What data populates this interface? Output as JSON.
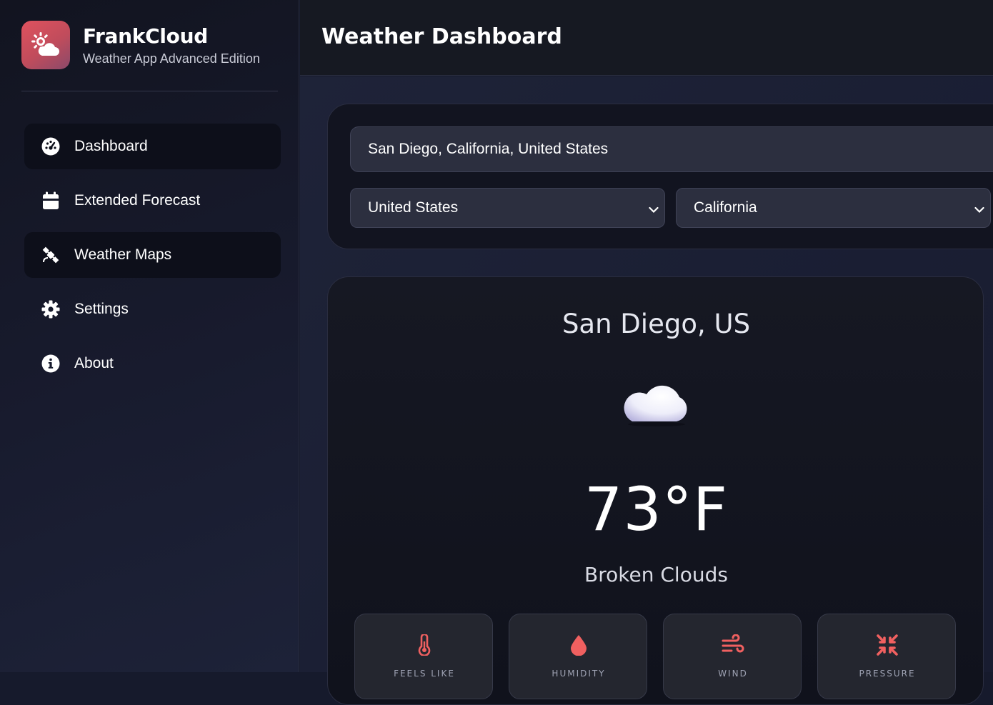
{
  "app": {
    "name": "FrankCloud",
    "subtitle": "Weather App Advanced Edition",
    "logo_icon": "sun-cloud-icon",
    "accent_color": "#e05460"
  },
  "sidebar": {
    "items": [
      {
        "label": "Dashboard",
        "icon": "gauge-icon",
        "active": true
      },
      {
        "label": "Extended Forecast",
        "icon": "calendar-icon",
        "active": false
      },
      {
        "label": "Weather Maps",
        "icon": "satellite-icon",
        "active": true
      },
      {
        "label": "Settings",
        "icon": "gear-icon",
        "active": false
      },
      {
        "label": "About",
        "icon": "info-icon",
        "active": false
      }
    ]
  },
  "header": {
    "title": "Weather Dashboard"
  },
  "search": {
    "value": "San Diego, California, United States",
    "country": "United States",
    "state": "California"
  },
  "weather": {
    "city": "San Diego, US",
    "icon": "cloud-icon",
    "temperature": "73°F",
    "condition": "Broken Clouds",
    "stats": [
      {
        "label": "Feels Like",
        "icon": "thermometer-icon"
      },
      {
        "label": "Humidity",
        "icon": "droplet-icon"
      },
      {
        "label": "Wind",
        "icon": "wind-icon"
      },
      {
        "label": "Pressure",
        "icon": "compress-icon"
      }
    ]
  }
}
